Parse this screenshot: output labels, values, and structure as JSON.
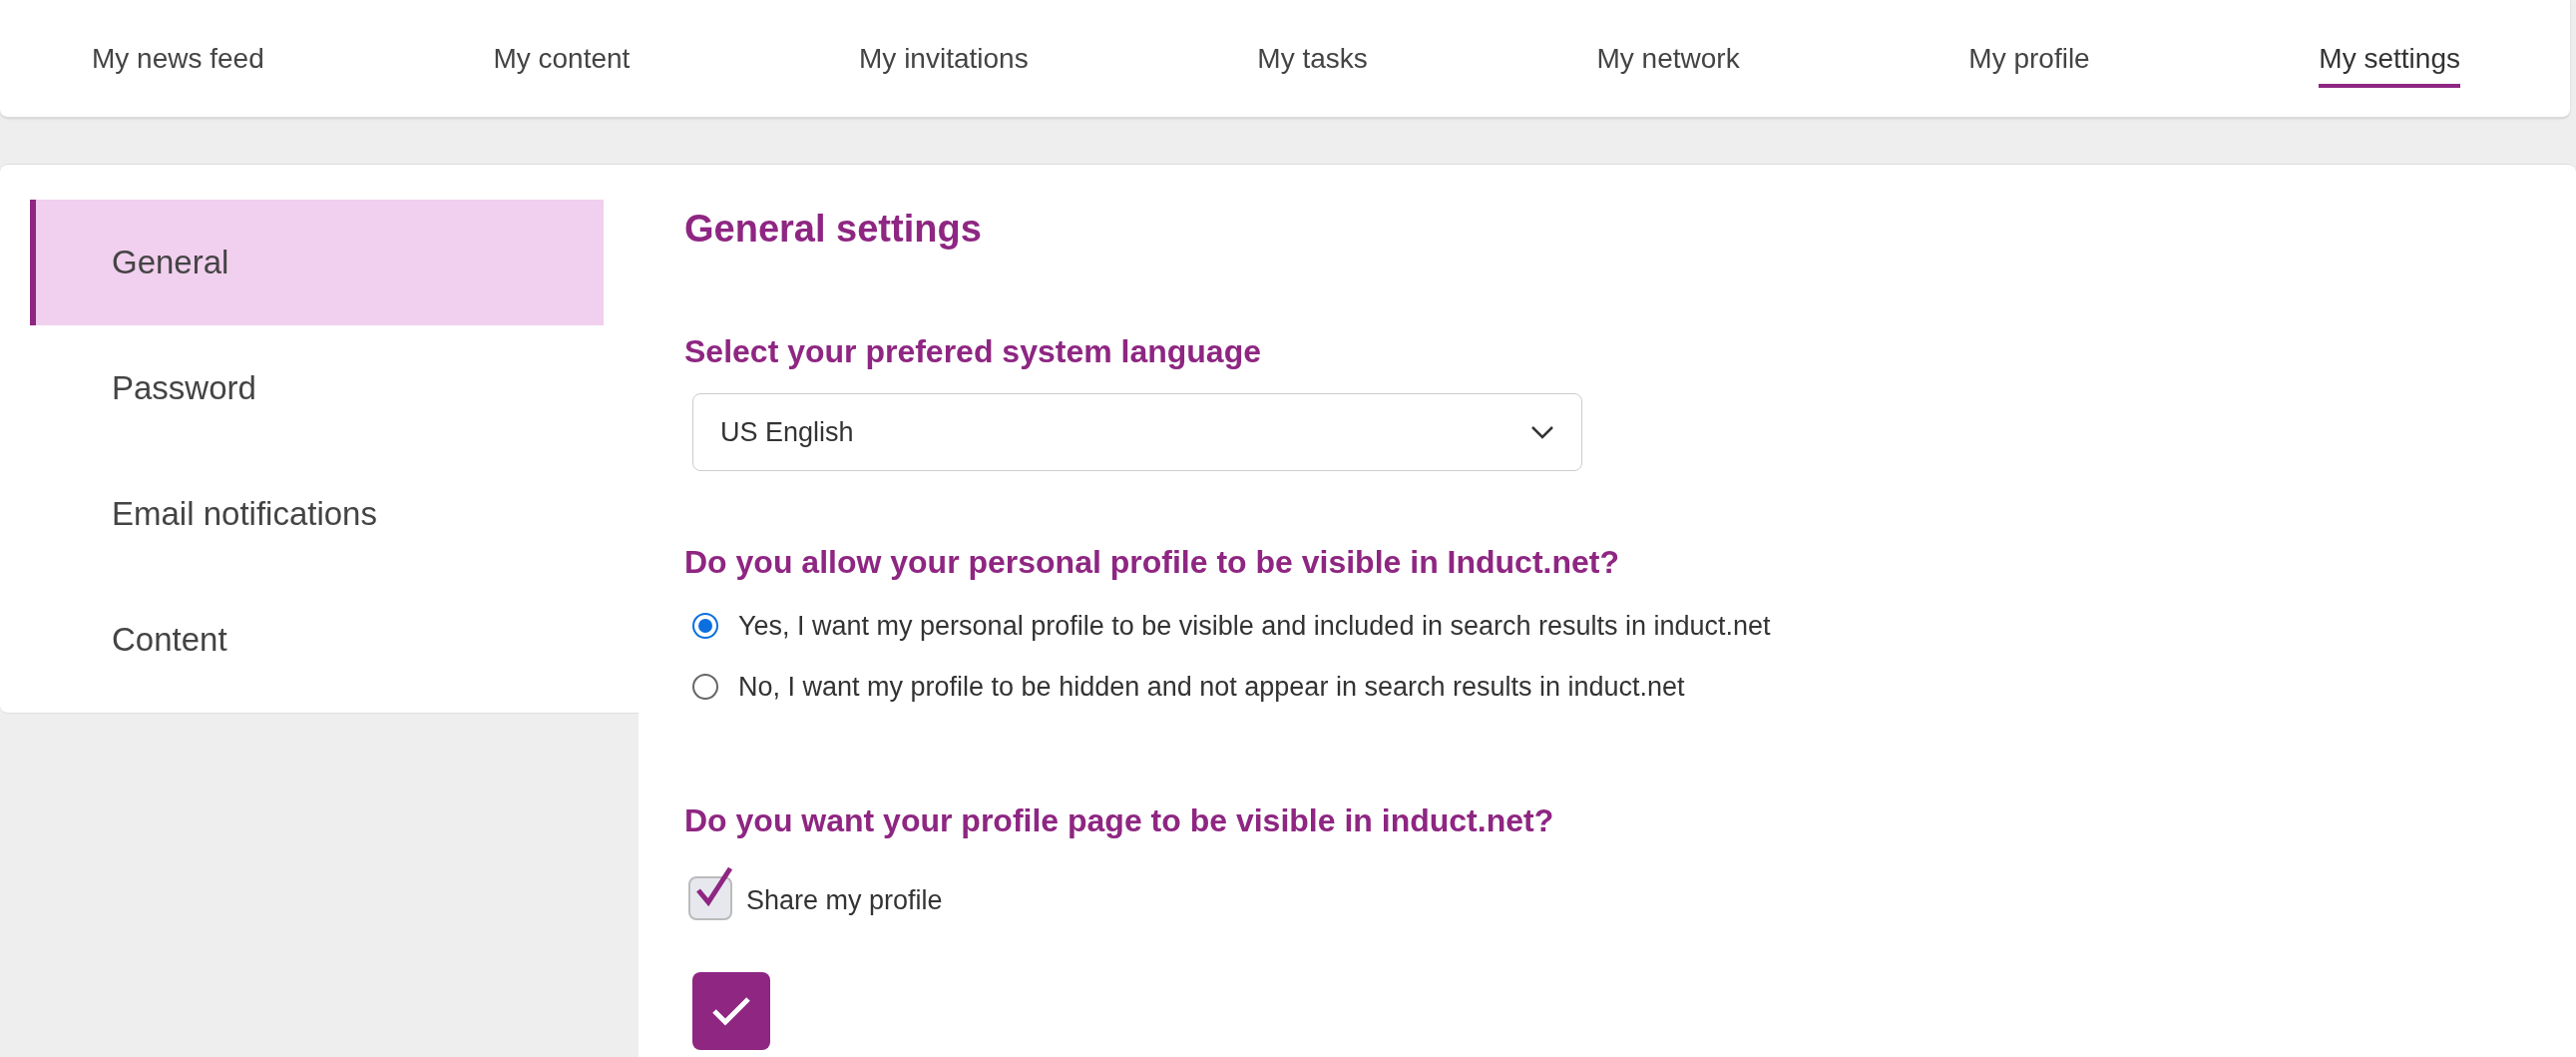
{
  "nav": {
    "items": [
      {
        "label": "My news feed",
        "selected": false
      },
      {
        "label": "My content",
        "selected": false
      },
      {
        "label": "My invitations",
        "selected": false
      },
      {
        "label": "My tasks",
        "selected": false
      },
      {
        "label": "My network",
        "selected": false
      },
      {
        "label": "My profile",
        "selected": false
      },
      {
        "label": "My settings",
        "selected": true
      }
    ]
  },
  "sidebar": {
    "items": [
      {
        "label": "General",
        "selected": true
      },
      {
        "label": "Password",
        "selected": false
      },
      {
        "label": "Email notifications",
        "selected": false
      },
      {
        "label": "Content",
        "selected": false
      }
    ]
  },
  "title": "General settings",
  "language": {
    "label": "Select your prefered system language",
    "value": "US English"
  },
  "profile_visibility": {
    "question": "Do you allow your personal profile to be visible in Induct.net?",
    "options": [
      {
        "label": "Yes, I want my personal profile to be visible and included in search results in induct.net",
        "selected": true
      },
      {
        "label": "No, I want my profile to be hidden and not appear in search results in induct.net",
        "selected": false
      }
    ]
  },
  "profile_page": {
    "question": "Do you want your profile page to be visible in induct.net?",
    "checkbox": {
      "label": "Share my profile",
      "checked": true
    }
  }
}
